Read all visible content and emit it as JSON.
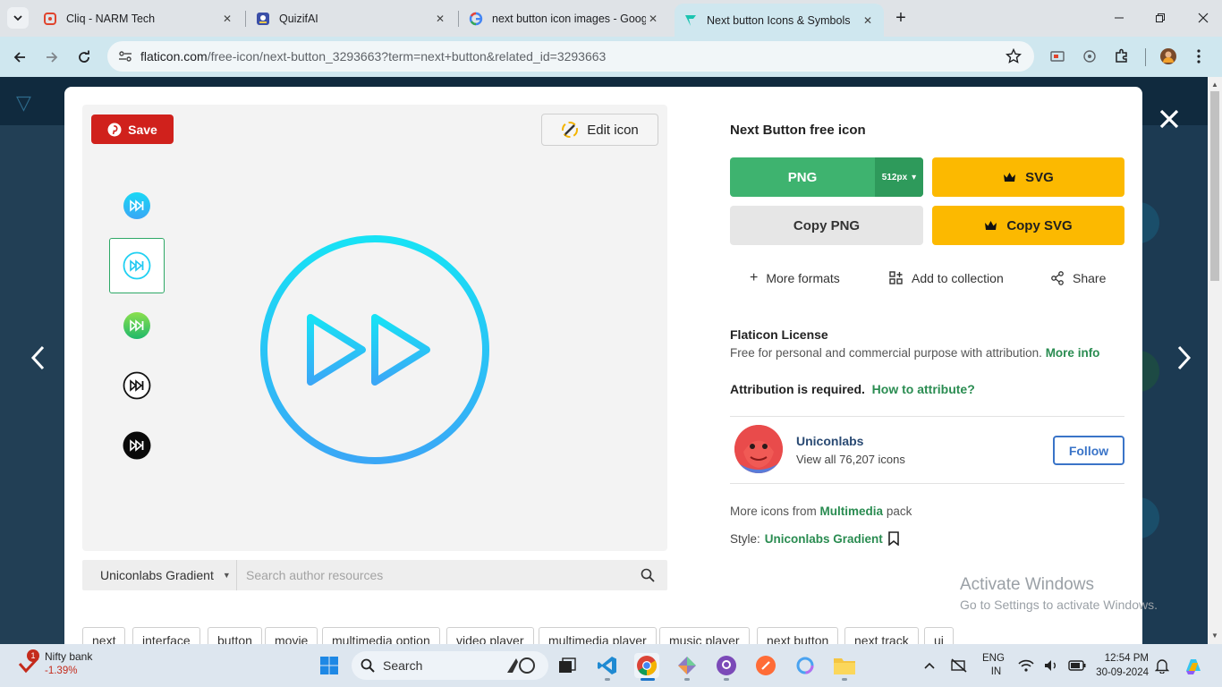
{
  "browser": {
    "tabs": [
      {
        "title": "Cliq - NARM Tech",
        "favicon": "cliq-icon"
      },
      {
        "title": "QuizifAI",
        "favicon": "quizifai-icon"
      },
      {
        "title": "next button icon images - Goog",
        "favicon": "google-icon"
      },
      {
        "title": "Next button Icons & Symbols",
        "favicon": "flaticon-icon",
        "active": true
      }
    ],
    "url_host": "flaticon.com",
    "url_path": "/free-icon/next-button_3293663?term=next+button&related_id=3293663"
  },
  "modal": {
    "save_label": "Save",
    "edit_label": "Edit icon",
    "icon_title": "Next Button free icon",
    "png_label": "PNG",
    "png_size": "512px",
    "svg_label": "SVG",
    "copy_png_label": "Copy PNG",
    "copy_svg_label": "Copy SVG",
    "more_formats": "More formats",
    "add_collection": "Add to collection",
    "share": "Share",
    "license_title": "Flaticon License",
    "license_text": "Free for personal and commercial purpose with attribution.",
    "more_info": "More info",
    "attribution_text": "Attribution is required.",
    "how_attribute": "How to attribute?",
    "author_name": "Uniconlabs",
    "author_sub": "View all 76,207 icons",
    "follow_label": "Follow",
    "pack_prefix": "More icons from",
    "pack_name": "Multimedia",
    "pack_suffix": "pack",
    "style_prefix": "Style:",
    "style_name": "Uniconlabs Gradient",
    "style_select": "Uniconlabs Gradient",
    "search_placeholder": "Search author resources",
    "tags": [
      "next",
      "interface",
      "button",
      "movie",
      "multimedia option",
      "video player",
      "multimedia player",
      "music player",
      "next button",
      "next track",
      "ui"
    ]
  },
  "watermark": {
    "line1": "Activate Windows",
    "line2": "Go to Settings to activate Windows."
  },
  "taskbar": {
    "stock_name": "Nifty bank",
    "stock_change": "-1.39%",
    "stock_badge": "1",
    "search_label": "Search",
    "lang1": "ENG",
    "lang2": "IN",
    "time": "12:54 PM",
    "date": "30-09-2024"
  },
  "colors": {
    "png_green": "#3eb36f",
    "svg_yellow": "#fcb900",
    "link_green": "#2a8c51",
    "icon_cyan": "#19d3f0",
    "pinterest_red": "#d0211c"
  }
}
